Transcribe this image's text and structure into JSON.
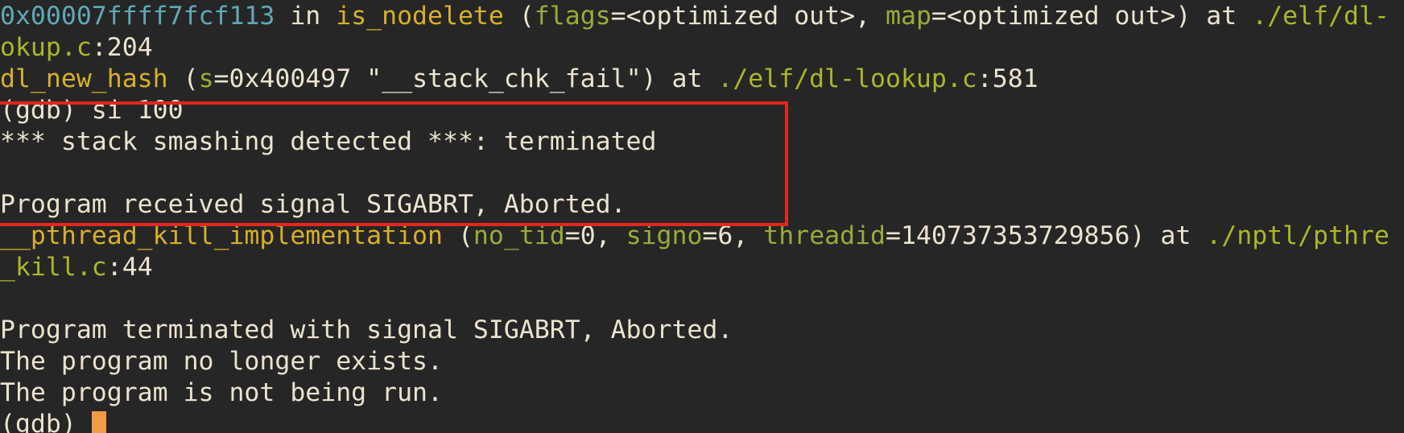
{
  "terminal": {
    "frame_line": {
      "address": "0x00007ffff7fcf113",
      "in": " in ",
      "function": "is_nodelete",
      "open": " (",
      "param1": "flags",
      "eq1": "=",
      "val1": "<optimized out>",
      "sep1": ", ",
      "param2": "map",
      "eq2": "=",
      "val2": "<optimized out>",
      "close_at": ") at ",
      "path_start": "./elf/dl-"
    },
    "frame_line_cont": {
      "path_end": "okup.c",
      "line_no": ":204"
    },
    "hash_line": {
      "function": "dl_new_hash",
      "open": " (",
      "param": "s",
      "eq": "=",
      "value": "0x400497 \"__stack_chk_fail\"",
      "close_at": ") at ",
      "path": "./elf/dl-lookup.c",
      "line_no": ":581"
    },
    "command_line": "(gdb) si 100",
    "smash_line": "*** stack smashing detected ***: terminated",
    "blank1": "",
    "signal_line": "Program received signal SIGABRT, Aborted.",
    "pthread_line": {
      "function": "__pthread_kill_implementation",
      "open": " (",
      "param1": "no_tid",
      "eq1": "=",
      "val1": "0",
      "sep1": ", ",
      "param2": "signo",
      "eq2": "=",
      "val2": "6",
      "sep2": ", ",
      "param3": "threadid",
      "eq3": "=",
      "val3": "140737353729856",
      "close_at": ") at ",
      "path_start": "./nptl/pthre"
    },
    "pthread_line_cont": {
      "path_end": "_kill.c",
      "line_no": ":44"
    },
    "blank2": "",
    "terminated_line": "Program terminated with signal SIGABRT, Aborted.",
    "no_longer_line": "The program no longer exists.",
    "not_running_line": "The program is not being run.",
    "prompt": "(gdb) "
  },
  "colors": {
    "background": "#262626",
    "text": "#ece3cf",
    "address": "#5fa9b7",
    "function": "#d7b02b",
    "parameter": "#9aab3a",
    "path": "#adb52b",
    "highlight_box": "#e5261d",
    "cursor": "#f39a4a"
  }
}
